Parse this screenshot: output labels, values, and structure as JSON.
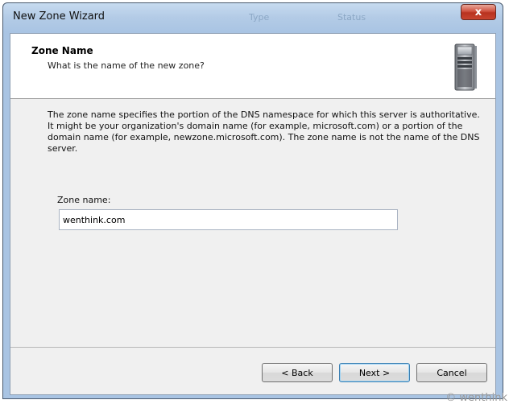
{
  "window": {
    "title": "New Zone Wizard",
    "ghost_texts": [
      "Type",
      "Status"
    ],
    "close_glyph": "x"
  },
  "header": {
    "title": "Zone Name",
    "subtitle": "What is the name of the new zone?",
    "icon": "server-tower-icon"
  },
  "body": {
    "description": "The zone name specifies the portion of the DNS namespace for which this server is authoritative. It might be your organization's domain name (for example, microsoft.com) or a portion of the domain name (for example, newzone.microsoft.com). The zone name is not the name of the DNS server.",
    "zone_label": "Zone name:",
    "zone_value": "wenthink.com"
  },
  "buttons": {
    "back": "< Back",
    "next": "Next >",
    "cancel": "Cancel"
  },
  "watermark": "wenthink",
  "colors": {
    "title_bar": "#b3cbe6",
    "close_button": "#c8442f",
    "client_bg": "#f0f0f0",
    "header_bg": "#ffffff"
  }
}
